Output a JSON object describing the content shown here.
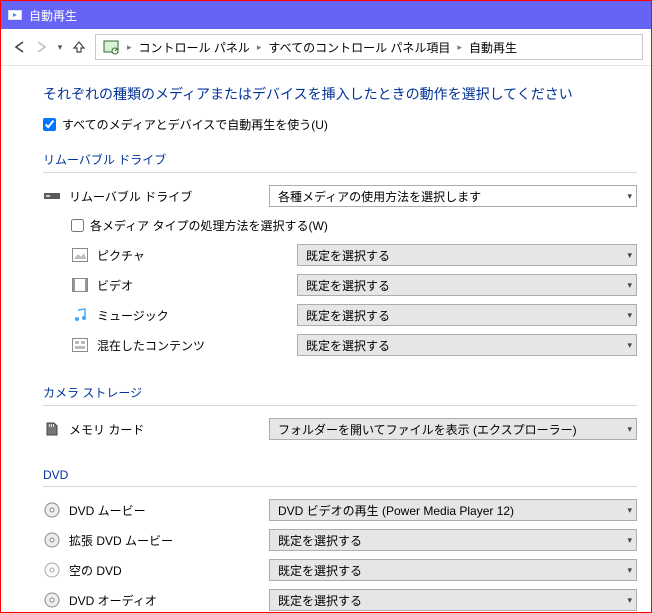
{
  "window": {
    "title": "自動再生"
  },
  "breadcrumb": {
    "seg1": "コントロール パネル",
    "seg2": "すべてのコントロール パネル項目",
    "seg3": "自動再生"
  },
  "heading": "それぞれの種類のメディアまたはデバイスを挿入したときの動作を選択してください",
  "master_checkbox": {
    "label": "すべてのメディアとデバイスで自動再生を使う(U)",
    "checked": true
  },
  "sections": {
    "removable": {
      "title": "リムーバブル ドライブ",
      "drive_label": "リムーバブル ドライブ",
      "drive_value": "各種メディアの使用方法を選択します",
      "sub_checkbox": {
        "label": "各メディア タイプの処理方法を選択する(W)",
        "checked": false
      },
      "items": [
        {
          "label": "ピクチャ",
          "value": "既定を選択する"
        },
        {
          "label": "ビデオ",
          "value": "既定を選択する"
        },
        {
          "label": "ミュージック",
          "value": "既定を選択する"
        },
        {
          "label": "混在したコンテンツ",
          "value": "既定を選択する"
        }
      ]
    },
    "camera": {
      "title": "カメラ ストレージ",
      "item": {
        "label": "メモリ カード",
        "value": "フォルダーを開いてファイルを表示 (エクスプローラー)"
      }
    },
    "dvd": {
      "title": "DVD",
      "items": [
        {
          "label": "DVD ムービー",
          "value": "DVD ビデオの再生 (Power Media Player 12)"
        },
        {
          "label": "拡張 DVD ムービー",
          "value": "既定を選択する"
        },
        {
          "label": "空の DVD",
          "value": "既定を選択する"
        },
        {
          "label": "DVD オーディオ",
          "value": "既定を選択する"
        }
      ]
    }
  }
}
